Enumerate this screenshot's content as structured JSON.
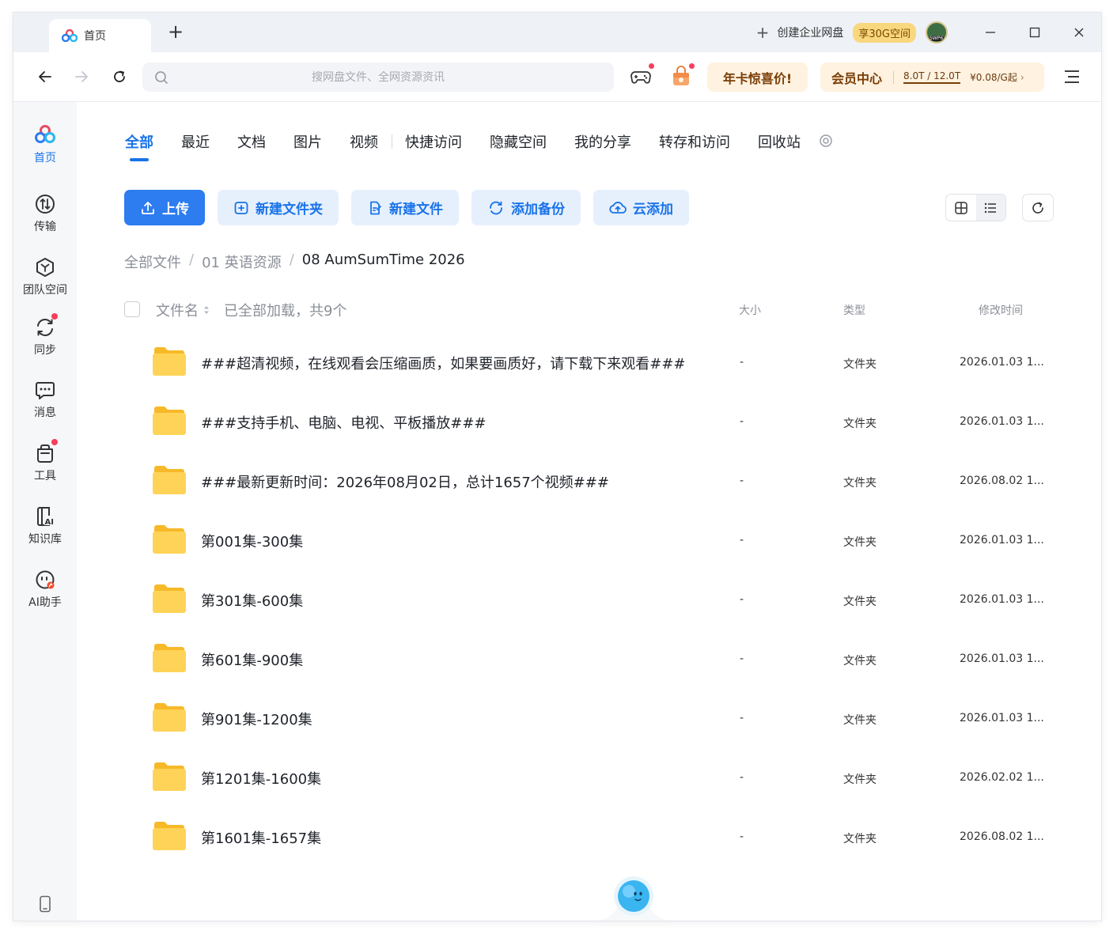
{
  "titlebar": {
    "tab_label": "首页",
    "new_tab_label": "+",
    "enterprise_label": "创建企业网盘",
    "enterprise_badge": "享30G空间"
  },
  "toolbar": {
    "search_placeholder": "搜网盘文件、全网资源资讯",
    "year_promo": "年卡惊喜价!",
    "vip_title": "会员中心",
    "vip_quota": "8.0T / 12.0T",
    "vip_price": "¥0.08/G起",
    "vip_arrow": "›"
  },
  "sidebar": {
    "items": [
      {
        "label": "首页",
        "icon": "home-logo-icon",
        "active": true
      },
      {
        "label": "传输",
        "icon": "transfer-icon"
      },
      {
        "label": "团队空间",
        "icon": "team-space-icon"
      },
      {
        "label": "同步",
        "icon": "sync-icon",
        "badge": true
      },
      {
        "label": "消息",
        "icon": "message-icon"
      },
      {
        "label": "工具",
        "icon": "tools-icon",
        "badge": true
      },
      {
        "label": "知识库",
        "icon": "knowledge-base-icon"
      },
      {
        "label": "AI助手",
        "icon": "ai-assistant-icon"
      }
    ]
  },
  "categories": [
    "全部",
    "最近",
    "文档",
    "图片",
    "视频",
    "快捷访问",
    "隐藏空间",
    "我的分享",
    "转存和访问",
    "回收站"
  ],
  "actions": {
    "upload": "上传",
    "new_folder": "新建文件夹",
    "new_file": "新建文件",
    "add_backup": "添加备份",
    "cloud_add": "云添加"
  },
  "breadcrumb": {
    "root": "全部文件",
    "level1": "01 英语资源",
    "current": "08 AumSumTime 2026",
    "separator": "/"
  },
  "list_header": {
    "name": "文件名",
    "loaded": "已全部加载，共9个",
    "size": "大小",
    "type": "类型",
    "modified": "修改时间"
  },
  "files": [
    {
      "name": "###超清视频，在线观看会压缩画质，如果要画质好，请下载下来观看###",
      "size": "-",
      "type": "文件夹",
      "modified": "2026.01.03 1..."
    },
    {
      "name": "###支持手机、电脑、电视、平板播放###",
      "size": "-",
      "type": "文件夹",
      "modified": "2026.01.03 1..."
    },
    {
      "name": "###最新更新时间：2026年08月02日，总计1657个视频###",
      "size": "-",
      "type": "文件夹",
      "modified": "2026.08.02 1..."
    },
    {
      "name": "第001集-300集",
      "size": "-",
      "type": "文件夹",
      "modified": "2026.01.03 1..."
    },
    {
      "name": "第301集-600集",
      "size": "-",
      "type": "文件夹",
      "modified": "2026.01.03 1..."
    },
    {
      "name": "第601集-900集",
      "size": "-",
      "type": "文件夹",
      "modified": "2026.01.03 1..."
    },
    {
      "name": "第901集-1200集",
      "size": "-",
      "type": "文件夹",
      "modified": "2026.01.03 1..."
    },
    {
      "name": "第1201集-1600集",
      "size": "-",
      "type": "文件夹",
      "modified": "2026.02.02 1..."
    },
    {
      "name": "第1601集-1657集",
      "size": "-",
      "type": "文件夹",
      "modified": "2026.08.02 1..."
    }
  ],
  "colors": {
    "accent": "#1a73e8",
    "primary_button": "#2d7cf0",
    "promo_bg": "#fff2e0",
    "badge_red": "#f53f5b",
    "folder_yellow": "#ffcf4a"
  }
}
